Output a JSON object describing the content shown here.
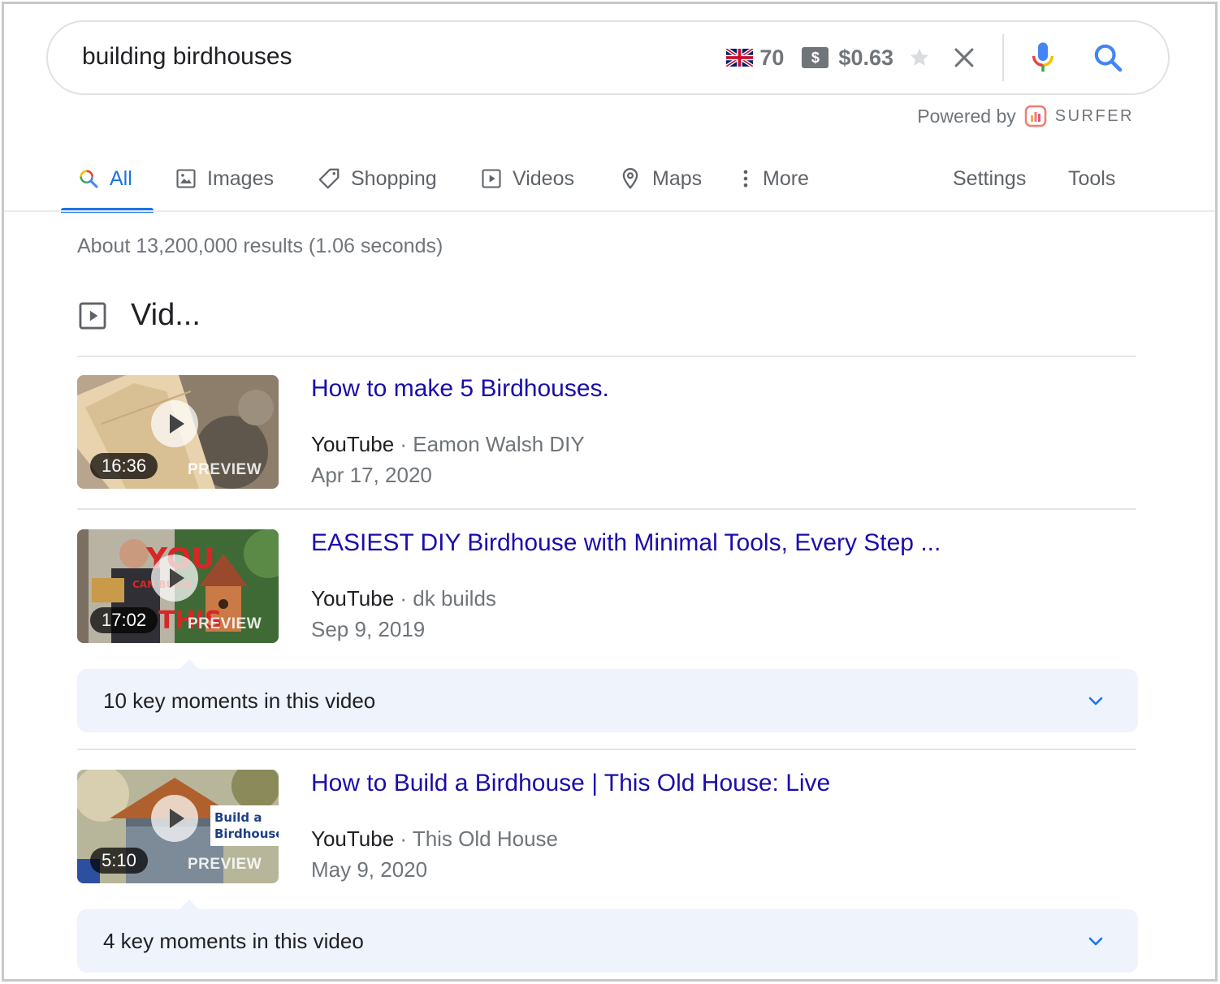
{
  "search": {
    "query": "building birdhouses",
    "keyword_volume": "70",
    "cpc": "$0.63",
    "volume_flag_icon": "uk-flag-icon",
    "cpc_icon": "dollar-icon",
    "dollar_glyph": "$"
  },
  "powered_by": {
    "label": "Powered by",
    "brand": "SURFER"
  },
  "tabs": [
    {
      "label": "All",
      "icon": "search-icon",
      "active": true
    },
    {
      "label": "Images",
      "icon": "image-icon"
    },
    {
      "label": "Shopping",
      "icon": "tag-icon"
    },
    {
      "label": "Videos",
      "icon": "video-icon"
    },
    {
      "label": "Maps",
      "icon": "map-pin-icon"
    },
    {
      "label": "More",
      "icon": "more-vertical-icon"
    }
  ],
  "tools": {
    "settings": "Settings",
    "tools": "Tools"
  },
  "result_stats": "About 13,200,000 results (1.06 seconds)",
  "videos_section": {
    "title": "Vid...",
    "items": [
      {
        "title": "How to make 5 Birdhouses.",
        "site": "YouTube",
        "separator": " · ",
        "channel": "Eamon Walsh DIY",
        "date": "Apr 17, 2020",
        "duration": "16:36",
        "preview": "PREVIEW"
      },
      {
        "title": "EASIEST DIY Birdhouse with Minimal Tools, Every Step ...",
        "site": "YouTube",
        "separator": " · ",
        "channel": "dk builds",
        "date": "Sep 9, 2019",
        "duration": "17:02",
        "preview": "PREVIEW",
        "thumb_text_1": "YOU",
        "thumb_text_2": "CAN BUILD",
        "thumb_text_3": "THIS",
        "key_moments": "10 key moments in this video"
      },
      {
        "title": "How to Build a Birdhouse | This Old House: Live",
        "site": "YouTube",
        "separator": " · ",
        "channel": "This Old House",
        "date": "May 9, 2020",
        "duration": "5:10",
        "preview": "PREVIEW",
        "thumb_text_1": "Build a",
        "thumb_text_2": "Birdhouse",
        "key_moments": "4 key moments in this video"
      }
    ]
  },
  "colors": {
    "link": "#1a0dab",
    "accent": "#1a73e8",
    "muted": "#70757a",
    "moments_bg": "#eff3fb"
  }
}
